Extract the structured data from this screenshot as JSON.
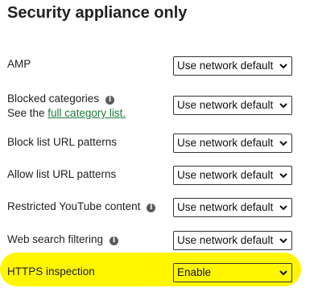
{
  "section": {
    "title": "Security appliance only"
  },
  "settings": [
    {
      "label": "AMP",
      "value": "Use network default"
    },
    {
      "label": "Blocked categories",
      "info": "info-icon",
      "sub_prefix": "See the ",
      "sub_link": "full category list.",
      "value": "Use network default"
    },
    {
      "label": "Block list URL patterns",
      "value": "Use network default"
    },
    {
      "label": "Allow list URL patterns",
      "value": "Use network default"
    },
    {
      "label": "Restricted YouTube content",
      "info": "info-icon",
      "value": "Use network default"
    },
    {
      "label": "Web search filtering",
      "info": "info-icon",
      "value": "Use network default"
    },
    {
      "label": "HTTPS inspection",
      "value": "Enable",
      "highlighted": true
    }
  ],
  "colors": {
    "highlight": "#fff600",
    "link": "#1f7a3c"
  }
}
